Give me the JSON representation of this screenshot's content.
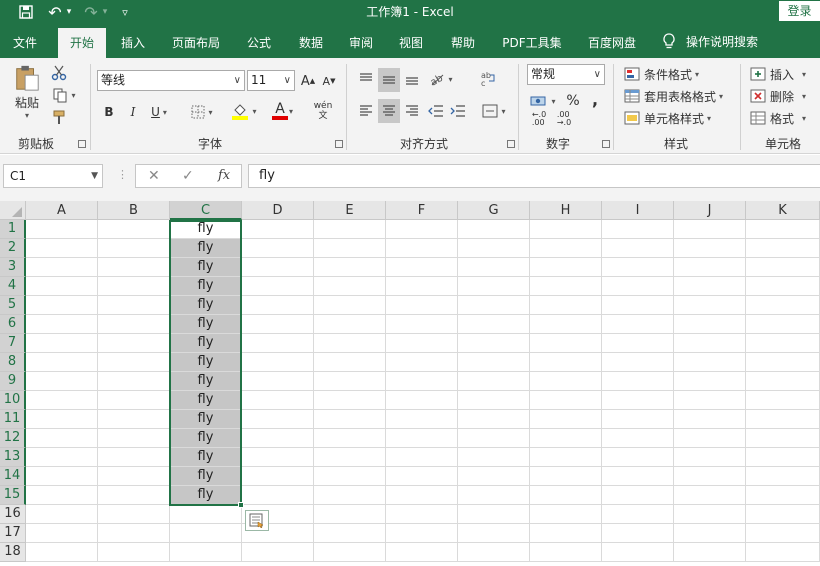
{
  "titlebar": {
    "title": "工作簿1  -  Excel",
    "login": "登录",
    "save_glyph": "💾",
    "undo_glyph": "↶",
    "redo_glyph": "↷",
    "dd_glyph": "▾",
    "custom_glyph": "▿"
  },
  "tabs": [
    "文件",
    "开始",
    "插入",
    "页面布局",
    "公式",
    "数据",
    "审阅",
    "视图",
    "帮助",
    "PDF工具集",
    "百度网盘"
  ],
  "active_tab": 1,
  "tellme": "操作说明搜索",
  "ribbon": {
    "clipboard": {
      "paste": "粘贴",
      "label": "剪贴板"
    },
    "font": {
      "name": "等线",
      "size": "11",
      "label": "字体",
      "grow": "A",
      "shrink": "A",
      "bold": "B",
      "italic": "I",
      "underline": "U",
      "font_color": "A",
      "phonetic": "wén\n文"
    },
    "alignment": {
      "label": "对齐方式"
    },
    "number": {
      "format": "常规",
      "percent": "%",
      "comma": ",",
      "inc": "←.0\n.00",
      "dec": ".00\n→.0",
      "label": "数字"
    },
    "styles": {
      "conditional": "条件格式",
      "table": "套用表格格式",
      "cell": "单元格样式",
      "label": "样式"
    },
    "cells": {
      "insert": "插入",
      "delete": "删除",
      "format": "格式",
      "label": "单元格"
    }
  },
  "formula_bar": {
    "name_box": "C1",
    "cancel": "✕",
    "enter": "✓",
    "fx": "fx",
    "value": "fly"
  },
  "columns": [
    "A",
    "B",
    "C",
    "D",
    "E",
    "F",
    "G",
    "H",
    "I",
    "J",
    "K"
  ],
  "rows": [
    "1",
    "2",
    "3",
    "4",
    "5",
    "6",
    "7",
    "8",
    "9",
    "10",
    "11",
    "12",
    "13",
    "14",
    "15",
    "16",
    "17",
    "18"
  ],
  "cells_c": [
    "fly",
    "fly",
    "fly",
    "fly",
    "fly",
    "fly",
    "fly",
    "fly",
    "fly",
    "fly",
    "fly",
    "fly",
    "fly",
    "fly",
    "fly"
  ],
  "colors": {
    "accent": "#217346",
    "selection_fill": "#c6c6c6"
  }
}
